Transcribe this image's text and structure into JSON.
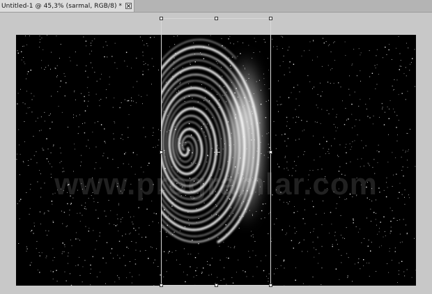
{
  "document_tab": {
    "title": "Untitled-1 @ 45,3% (sarmal, RGB/8) *",
    "close_icon": "close-icon"
  },
  "canvas": {
    "background": "#000000",
    "watermark": "www.programlar.com",
    "layer_content": "spiral-galaxy-swirl"
  },
  "transform": {
    "active": true,
    "pivot_icon": "crosshair-icon"
  },
  "colors": {
    "pasteboard": "#c8c8c8",
    "tabbar": "#b4b4b4",
    "tab_active": "#dcdcdc",
    "swirl": "#ffffff"
  }
}
